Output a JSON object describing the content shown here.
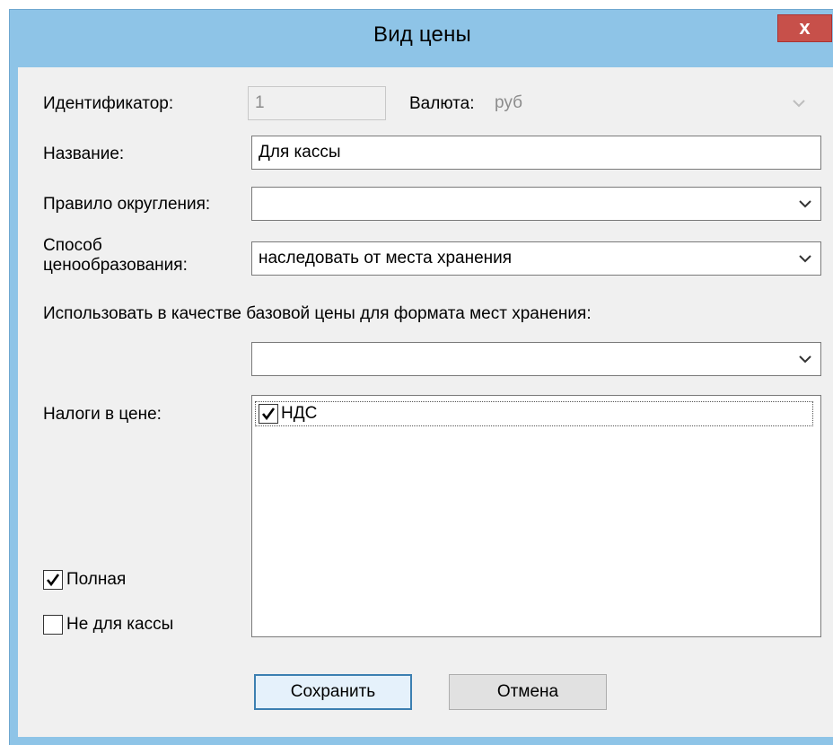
{
  "window": {
    "title": "Вид цены",
    "close_label": "x"
  },
  "form": {
    "id_label": "Идентификатор:",
    "id_value": "1",
    "currency_label": "Валюта:",
    "currency_value": "руб",
    "name_label": "Название:",
    "name_value": "Для кассы",
    "rounding_label": "Правило округления:",
    "rounding_value": "",
    "pricing_label_line1": "Способ",
    "pricing_label_line2": "ценообразования:",
    "pricing_value": "наследовать от места хранения",
    "base_price_label": "Использовать в качестве базовой цены для формата мест хранения:",
    "base_price_value": "",
    "taxes_label": "Налоги в цене:",
    "taxes": [
      {
        "label": "НДС",
        "checked": true
      }
    ],
    "full_label": "Полная",
    "full_checked": true,
    "not_for_cash_label": "Не для кассы",
    "not_for_cash_checked": false
  },
  "buttons": {
    "save": "Сохранить",
    "cancel": "Отмена"
  },
  "icons": {
    "combo_arrow": "chevron-down-icon",
    "check": "checkmark-icon",
    "close": "close-icon"
  }
}
